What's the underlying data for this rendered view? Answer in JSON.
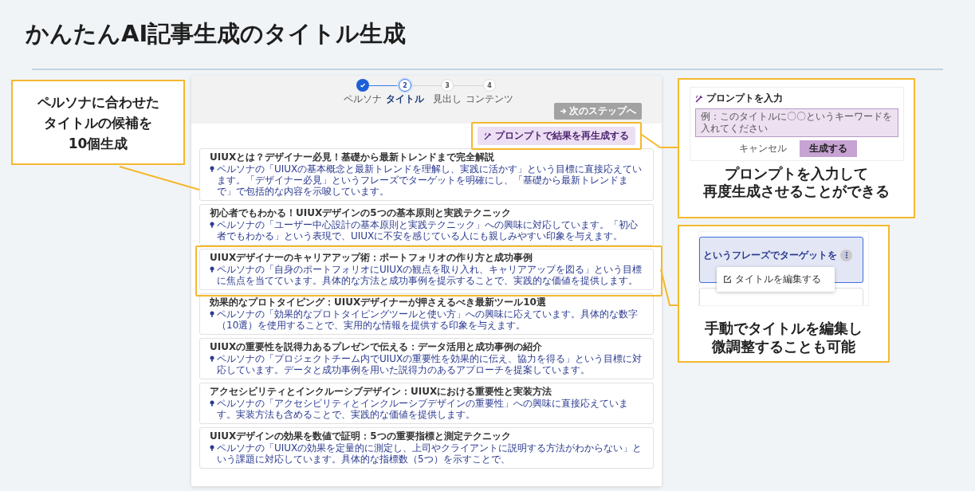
{
  "title": "かんたんAI記事生成のタイトル生成",
  "app": {
    "steps": [
      {
        "label": "ペルソナ",
        "completed": true,
        "selected": false
      },
      {
        "number": "2",
        "label": "タイトル",
        "completed": false,
        "selected": true
      },
      {
        "number": "3",
        "label": "見出し",
        "completed": false,
        "selected": false
      },
      {
        "number": "4",
        "label": "コンテンツ",
        "completed": false,
        "selected": false
      }
    ],
    "next_button": "次のステップへ",
    "regenerate_button": "プロンプトで結果を再生成する",
    "titles": [
      {
        "title": "UIUXとは？デザイナー必見！基礎から最新トレンドまで完全解説",
        "reason": "ペルソナの「UIUXの基本概念と最新トレンドを理解し、実践に活かす」という目標に直接応えています。「デザイナー必見」というフレーズでターゲットを明確にし、「基礎から最新トレンドまで」で包括的な内容を示唆しています。"
      },
      {
        "title": "初心者でもわかる！UIUXデザインの5つの基本原則と実践テクニック",
        "reason": "ペルソナの「ユーザー中心設計の基本原則と実践テクニック」への興味に対応しています。「初心者でもわかる」という表現で、UIUXに不安を感じている人にも親しみやすい印象を与えます。"
      },
      {
        "title": "UIUXデザイナーのキャリアアップ術：ポートフォリオの作り方と成功事例",
        "reason": "ペルソナの「自身のポートフォリオにUIUXの観点を取り入れ、キャリアアップを図る」という目標に焦点を当てています。具体的な方法と成功事例を提示することで、実践的な価値を提供します。"
      },
      {
        "title": "効果的なプロトタイピング：UIUXデザイナーが押さえるべき最新ツール10選",
        "reason": "ペルソナの「効果的なプロトタイピングツールと使い方」への興味に応えています。具体的な数字（10選）を使用することで、実用的な情報を提供する印象を与えます。"
      },
      {
        "title": "UIUXの重要性を説得力あるプレゼンで伝える：データ活用と成功事例の紹介",
        "reason": "ペルソナの「プロジェクトチーム内でUIUXの重要性を効果的に伝え、協力を得る」という目標に対応しています。データと成功事例を用いた説得力のあるアプローチを提案しています。"
      },
      {
        "title": "アクセシビリティとインクルーシブデザイン：UIUXにおける重要性と実装方法",
        "reason": "ペルソナの「アクセシビリティとインクルーシブデザインの重要性」への興味に直接応えています。実装方法も含めることで、実践的な価値を提供します。"
      },
      {
        "title": "UIUXデザインの効果を数値で証明：5つの重要指標と測定テクニック",
        "reason": "ペルソナの「UIUXの効果を定量的に測定し、上司やクライアントに説明する方法がわからない」という課題に対応しています。具体的な指標数（5つ）を示すことで、"
      }
    ]
  },
  "callouts": [
    {
      "kind": "text",
      "lines": [
        "ペルソナに合わせた",
        "タイトルの候補を",
        "10個生成"
      ]
    },
    {
      "kind": "prompt",
      "heading": "プロンプトを入力",
      "placeholder": "例：このタイトルに〇〇というキーワードを入れてください",
      "cancel": "キャンセル",
      "submit": "生成する",
      "lines": [
        "プロンプトを入力して",
        "再度生成させることができる"
      ]
    },
    {
      "kind": "edit",
      "snippet": "というフレーズでターゲットを",
      "menu_item": "タイトルを編集する",
      "lines": [
        "手動でタイトルを編集し",
        "微調整することも可能"
      ]
    }
  ]
}
